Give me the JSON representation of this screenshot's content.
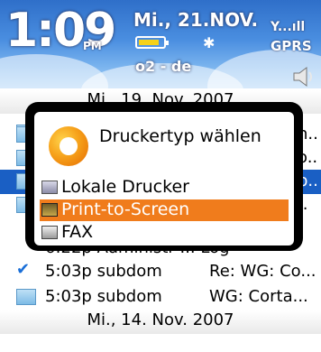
{
  "status": {
    "time": "1:09",
    "ampm": "PM",
    "date": "Mi., 21.NOV.",
    "carrier": "o2 - de",
    "signal": "Y...ıll",
    "network": "GPRS",
    "battery_level": 0.85,
    "battery_color": "#f6d21a"
  },
  "list": {
    "rows_top": [
      {
        "icon": "envelope-icon",
        "right": "n.."
      },
      {
        "icon": "envelope-icon",
        "right": "o.."
      },
      {
        "icon": "envelope-icon",
        "right": "p.."
      },
      {
        "icon": "envelope-icon",
        "right": ".."
      }
    ],
    "header_partial": "Mi., 19. Nov. 2007",
    "partial_row": "6:22p Administr ... Log",
    "rows": [
      {
        "icon": "checkmark-icon",
        "time_sender": "5:03p subdom",
        "subject": "Re: WG: Co..."
      },
      {
        "icon": "envelope-icon",
        "time_sender": "5:03p subdom",
        "subject": "WG: Corta..."
      }
    ],
    "day_header": "Mi., 14. Nov. 2007"
  },
  "dialog": {
    "title": "Druckertyp wählen",
    "options": [
      {
        "label": "Lokale Drucker",
        "icon": "printer-icon",
        "selected": false
      },
      {
        "label": "Print-to-Screen",
        "icon": "screen-icon",
        "selected": true
      },
      {
        "label": "FAX",
        "icon": "fax-icon",
        "selected": false
      }
    ]
  },
  "colors": {
    "selection": "#f07c1c",
    "status_bg": "#4a8ee0"
  }
}
